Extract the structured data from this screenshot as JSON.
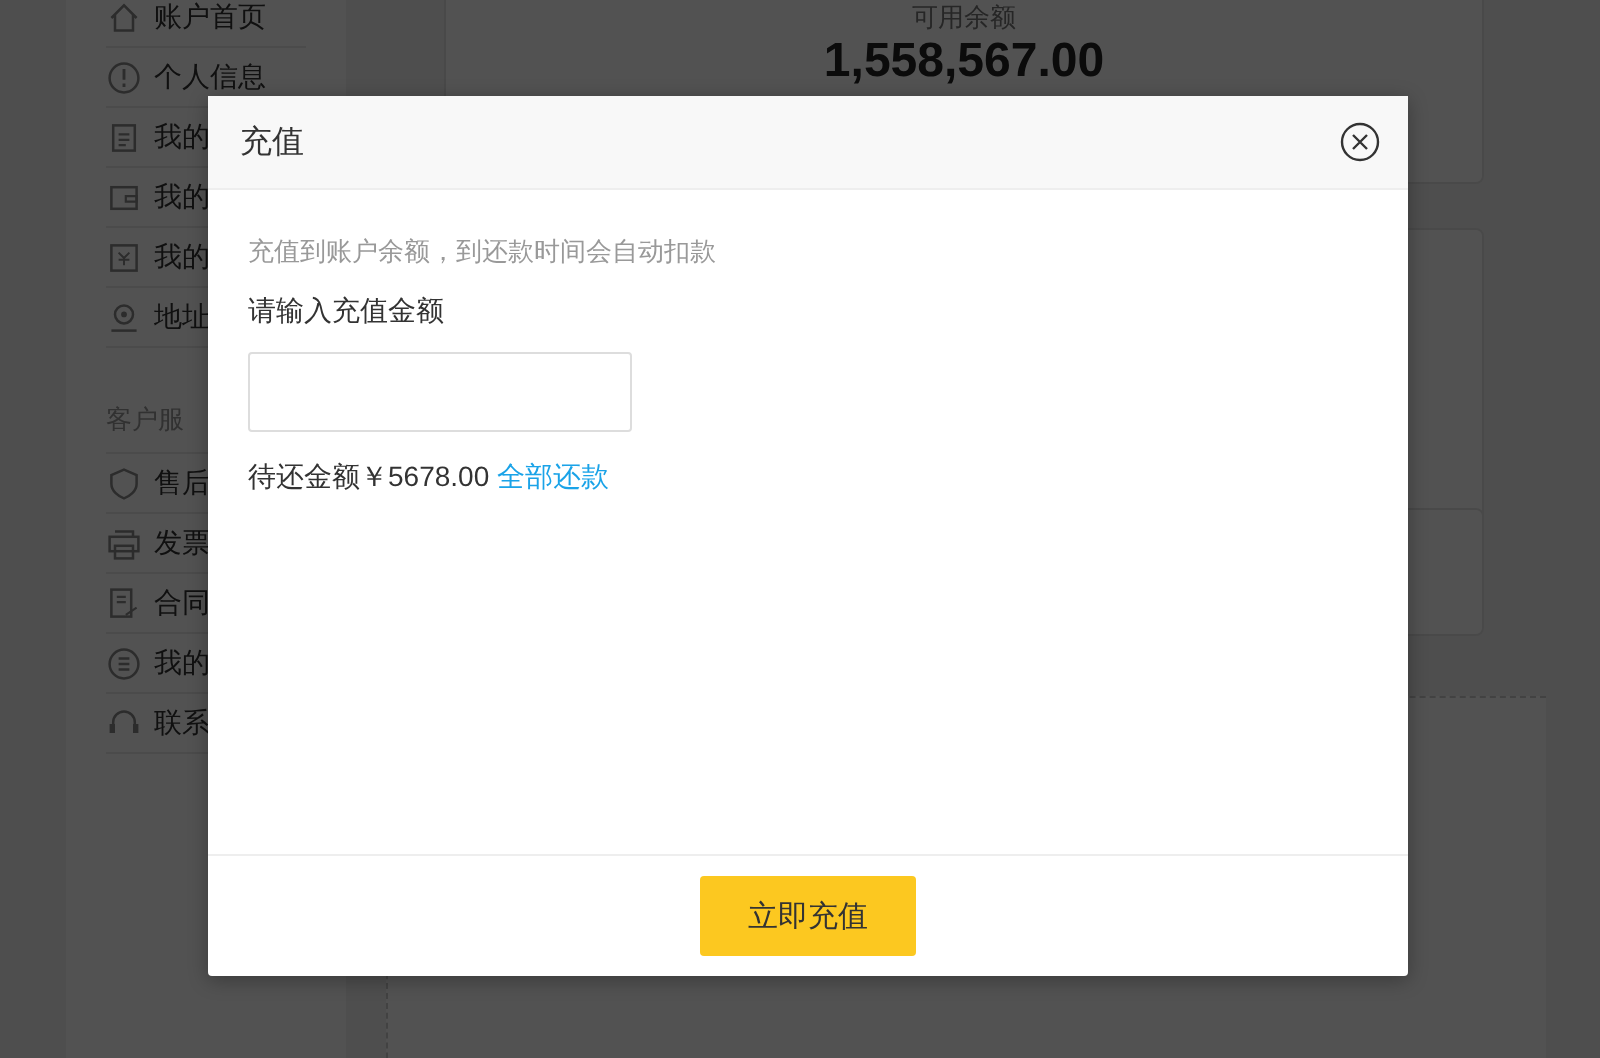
{
  "sidebar": {
    "groups": [
      {
        "items": [
          {
            "label": "账户首页"
          },
          {
            "label": "个人信息"
          },
          {
            "label": "我的"
          },
          {
            "label": "我的"
          },
          {
            "label": "我的"
          },
          {
            "label": "地址"
          }
        ]
      },
      {
        "heading": "客户服",
        "items": [
          {
            "label": "售后"
          },
          {
            "label": "发票"
          },
          {
            "label": "合同"
          },
          {
            "label": "我的"
          },
          {
            "label": "联系"
          }
        ]
      }
    ]
  },
  "balance_card": {
    "label": "可用余额",
    "amount": "1,558,567.00"
  },
  "dialog": {
    "title": "充值",
    "hint": "充值到账户余额，到还款时间会自动扣款",
    "field_label": "请输入充值金额",
    "owed_text": "待还金额￥5678.00",
    "owed_link": "全部还款",
    "submit": "立即充值"
  }
}
